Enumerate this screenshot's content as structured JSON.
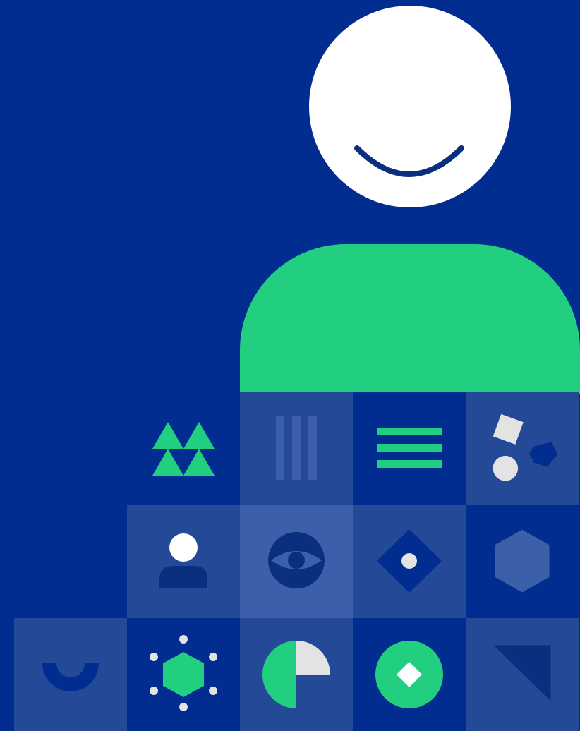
{
  "colors": {
    "background": "#002d8f",
    "white": "#ffffff",
    "green": "#22cf80",
    "tile_mid": "#244a97",
    "tile_light": "#3b5fa8",
    "navy": "#0a2f7e",
    "light_gray": "#e3e3e3"
  },
  "illustration": {
    "figure": [
      "smiling-head",
      "green-torso"
    ],
    "tile_icons": [
      "triangles-icon",
      "vertical-bars-icon",
      "menu-lines-icon",
      "shapes-icon",
      "person-icon",
      "eye-icon",
      "diamond-icon",
      "hexagon-icon",
      "smile-arc-icon",
      "hexagon-network-icon",
      "pie-chart-icon",
      "diamond-circle-icon",
      "corner-triangle-icon"
    ]
  }
}
